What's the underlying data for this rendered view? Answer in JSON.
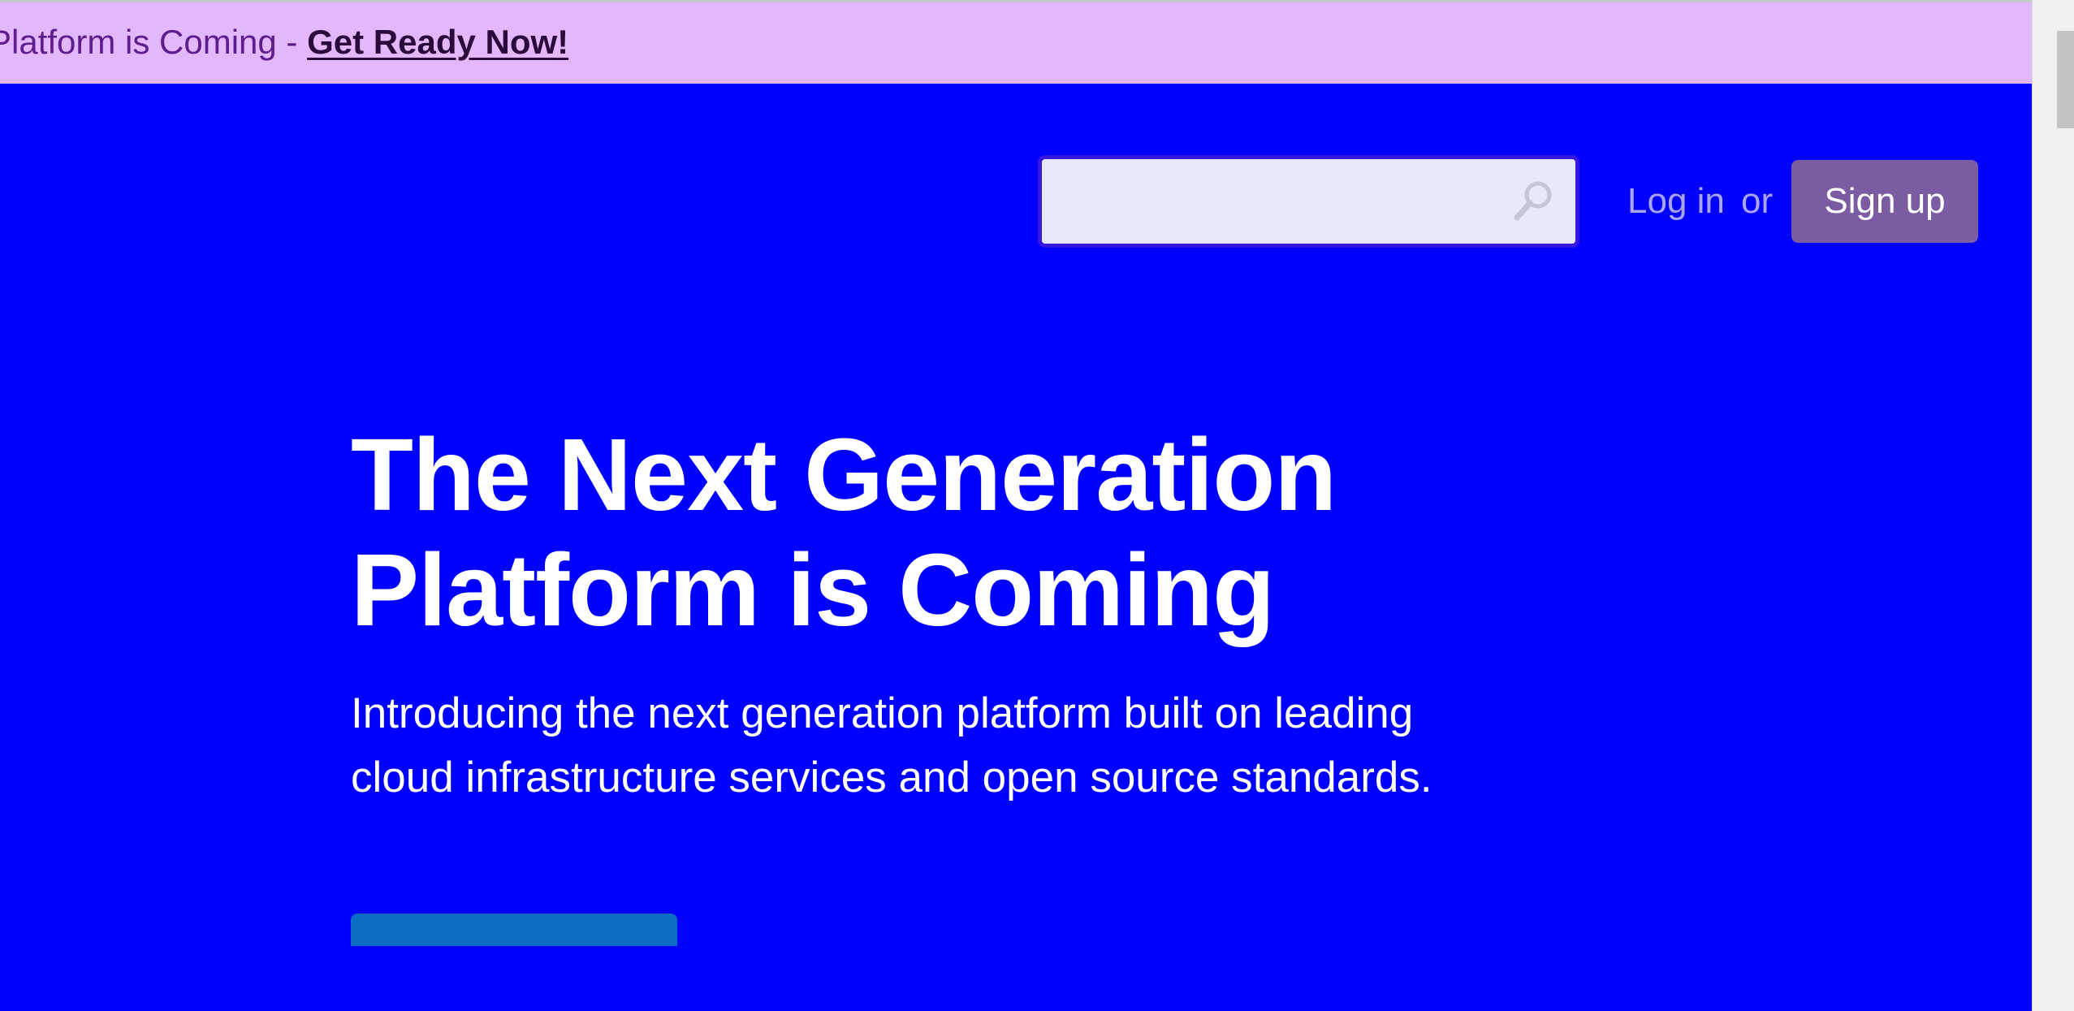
{
  "announcement": {
    "text": "Platform is Coming - ",
    "link_label": "Get Ready Now!"
  },
  "header": {
    "search": {
      "value": "",
      "placeholder": ""
    },
    "login_label": "Log in",
    "or_label": "or",
    "signup_label": "Sign up"
  },
  "hero": {
    "title": "The Next Generation Platform is Coming",
    "description": "Introducing the next generation platform built on leading cloud infrastructure services and open source standards."
  },
  "icons": {
    "search": "search-icon"
  },
  "colors": {
    "hero_background": "#0000ff",
    "announcement_background": "#e3b7fb",
    "announcement_text": "#5e1d8f",
    "signup_background": "#7b5ba2",
    "link_muted": "#a9a4ef",
    "cta_background": "#0a6fc2"
  }
}
